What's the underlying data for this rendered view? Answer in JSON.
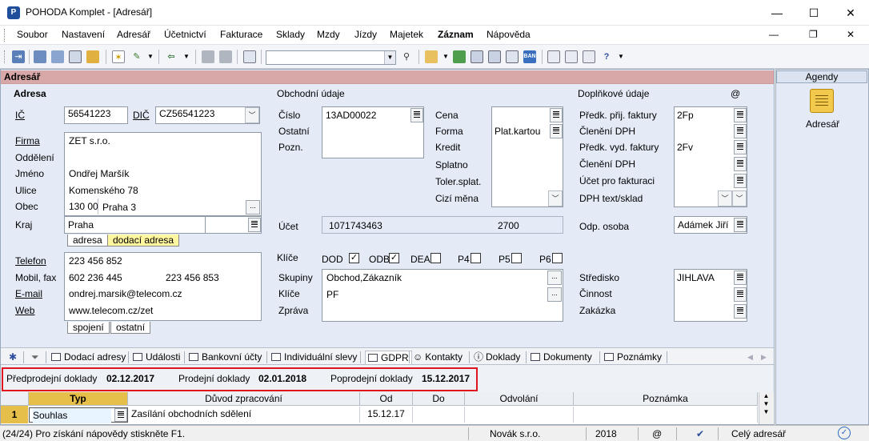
{
  "window": {
    "title": "POHODA Komplet - [Adresář]",
    "minimize": "—",
    "maximize": "☐",
    "close": "✕",
    "inner_minimize": "—",
    "inner_restore": "❐",
    "inner_close": "✕"
  },
  "menu": [
    "Soubor",
    "Nastavení",
    "Adresář",
    "Účetnictví",
    "Fakturace",
    "Sklady",
    "Mzdy",
    "Jízdy",
    "Majetek",
    "Záznam",
    "Nápověda"
  ],
  "toolbar": {
    "search_value": ""
  },
  "panel": {
    "title": "Adresář"
  },
  "adresa": {
    "section": "Adresa",
    "ic_label": "IČ",
    "ic": "56541223",
    "dic_label": "DIČ",
    "dic": "CZ56541223",
    "firma_label": "Firma",
    "firma": "ZET s.r.o.",
    "oddeleni_label": "Oddělení",
    "oddeleni": "",
    "jmeno_label": "Jméno",
    "jmeno": "Ondřej Maršík",
    "ulice_label": "Ulice",
    "ulice": "Komenského 78",
    "obec_label": "Obec",
    "psc": "130 00",
    "obec": "Praha 3",
    "kraj_label": "Kraj",
    "kraj": "Praha",
    "subtab_adresa": "adresa",
    "subtab_dodaci": "dodací adresa",
    "telefon_label": "Telefon",
    "telefon": "223 456 852",
    "mobil_label": "Mobil, fax",
    "mobil": "602 236 445",
    "fax": "223 456 853",
    "email_label": "E-mail",
    "email": "ondrej.marsik@telecom.cz",
    "web_label": "Web",
    "web": "www.telecom.cz/zet",
    "subtab_spojeni": "spojení",
    "subtab_ostatni": "ostatní"
  },
  "obchodni": {
    "section": "Obchodní údaje",
    "cislo_label": "Číslo",
    "cislo": "13AD00022",
    "ostatni_label": "Ostatní",
    "pozn_label": "Pozn.",
    "cena_label": "Cena",
    "forma_label": "Forma",
    "forma": "Plat.kartou",
    "kredit_label": "Kredit",
    "splatno_label": "Splatno",
    "toler_label": "Toler.splat.",
    "cizi_mena_label": "Cizí měna",
    "ucet_label": "Účet",
    "ucet": "1071743463",
    "ucet_kod": "2700",
    "klice_label": "Klíče",
    "checks": [
      {
        "label": "DOD",
        "checked": true
      },
      {
        "label": "ODB",
        "checked": true
      },
      {
        "label": "DEA",
        "checked": false
      },
      {
        "label": "P4",
        "checked": false
      },
      {
        "label": "P5",
        "checked": false
      },
      {
        "label": "P6",
        "checked": false
      }
    ],
    "skupiny_label": "Skupiny",
    "skupiny": "Obchod,Zákazník",
    "klice2_label": "Klíče",
    "klice2": "PF",
    "zprava_label": "Zpráva"
  },
  "doplnkove": {
    "section": "Doplňkové údaje",
    "at": "@",
    "predk_prij_label": "Předk. přij. faktury",
    "predk_prij": "2Fp",
    "cleneni1_label": "Členění DPH",
    "predk_vyd_label": "Předk. vyd. faktury",
    "predk_vyd": "2Fv",
    "cleneni2_label": "Členění DPH",
    "ucet_fakt_label": "Účet pro fakturaci",
    "dph_text_label": "DPH text/sklad",
    "odp_osoba_label": "Odp. osoba",
    "odp_osoba": "Adámek Jiří",
    "stredisko_label": "Středisko",
    "stredisko": "JIHLAVA",
    "cinnost_label": "Činnost",
    "zakazka_label": "Zakázka"
  },
  "bottom_tabs": [
    "Dodací adresy",
    "Události",
    "Bankovní účty",
    "Individuální slevy",
    "GDPR",
    "Kontakty",
    "Doklady",
    "Dokumenty",
    "Poznámky"
  ],
  "dates": {
    "predprodejni_label": "Předprodejní doklady",
    "predprodejni": "02.12.2017",
    "prodejni_label": "Prodejní doklady",
    "prodejni": "02.01.2018",
    "poprodejni_label": "Poprodejní doklady",
    "poprodejni": "15.12.2017"
  },
  "grid": {
    "headers": [
      "Typ",
      "Důvod zpracování",
      "Od",
      "Do",
      "Odvolání",
      "Poznámka"
    ],
    "rows": [
      {
        "num": "1",
        "typ": "Souhlas",
        "duvod": "Zasílání obchodních sdělení",
        "od": "15.12.17",
        "do": "",
        "odvolani": "",
        "poznamka": ""
      }
    ]
  },
  "agenda": {
    "header": "Agendy",
    "item": "Adresář"
  },
  "status": {
    "help": "(24/24) Pro získání nápovědy stiskněte F1.",
    "company": "Novák s.r.o.",
    "year": "2018",
    "at": "@",
    "scope": "Celý adresář"
  }
}
